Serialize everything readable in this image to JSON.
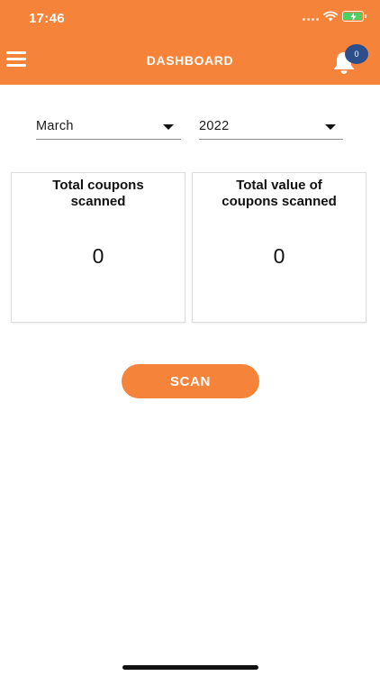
{
  "status_bar": {
    "time": "17:46",
    "icons": [
      "cellular-signal-icon",
      "wifi-icon",
      "battery-charging-icon"
    ]
  },
  "header": {
    "title": "DASHBOARD",
    "menu_icon": "hamburger-menu-icon",
    "notification_icon": "bell-icon",
    "notification_count": "0"
  },
  "filters": {
    "month": "March",
    "year": "2022"
  },
  "cards": [
    {
      "title": "Total coupons scanned",
      "value": "0"
    },
    {
      "title": "Total value of coupons scanned",
      "value": "0"
    }
  ],
  "scan_button": {
    "label": "SCAN"
  },
  "colors": {
    "brand": "#f5843a",
    "badge": "#2c4f8c",
    "battery": "#49d25f"
  }
}
